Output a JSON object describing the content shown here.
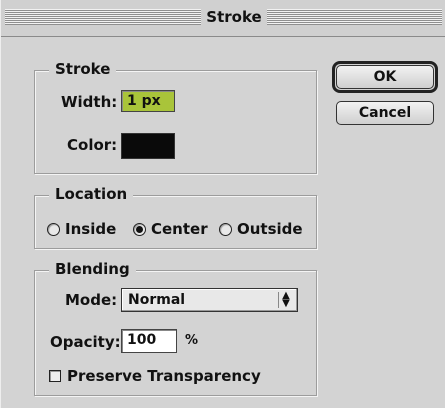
{
  "dialog": {
    "title": "Stroke"
  },
  "stroke_group": {
    "label": "Stroke",
    "width_label": "Width:",
    "width_value": "1 px",
    "color_label": "Color:",
    "color_value": "#0a0a0a"
  },
  "location_group": {
    "label": "Location",
    "options": [
      {
        "label": "Inside",
        "selected": false
      },
      {
        "label": "Center",
        "selected": true
      },
      {
        "label": "Outside",
        "selected": false
      }
    ]
  },
  "blending_group": {
    "label": "Blending",
    "mode_label": "Mode:",
    "mode_value": "Normal",
    "opacity_label": "Opacity:",
    "opacity_value": "100",
    "opacity_unit": "%",
    "preserve_label": "Preserve Transparency",
    "preserve_checked": false
  },
  "buttons": {
    "ok": "OK",
    "cancel": "Cancel"
  }
}
